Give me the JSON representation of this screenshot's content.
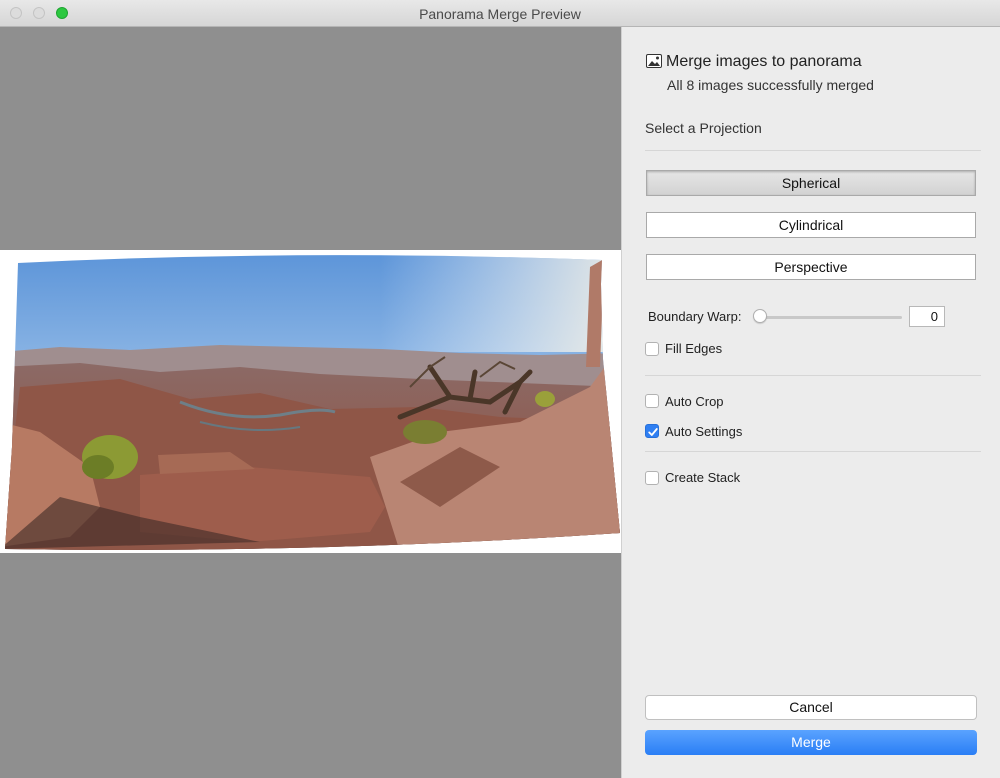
{
  "window": {
    "background_title": "",
    "title": "Panorama Merge Preview"
  },
  "header": {
    "icon": "image-icon",
    "title": "Merge images to panorama",
    "status": "All 8 images successfully merged"
  },
  "projection": {
    "heading": "Select a Projection",
    "options": [
      {
        "label": "Spherical",
        "selected": true
      },
      {
        "label": "Cylindrical",
        "selected": false
      },
      {
        "label": "Perspective",
        "selected": false
      }
    ]
  },
  "boundary_warp": {
    "label": "Boundary Warp:",
    "value": "0"
  },
  "checkboxes": {
    "fill_edges": {
      "label": "Fill Edges",
      "checked": false
    },
    "auto_crop": {
      "label": "Auto Crop",
      "checked": false
    },
    "auto_settings": {
      "label": "Auto Settings",
      "checked": true
    },
    "create_stack": {
      "label": "Create Stack",
      "checked": false
    }
  },
  "actions": {
    "cancel": "Cancel",
    "merge": "Merge"
  },
  "colors": {
    "accent": "#2f7ff2",
    "preview_bg": "#8f8f8f"
  }
}
